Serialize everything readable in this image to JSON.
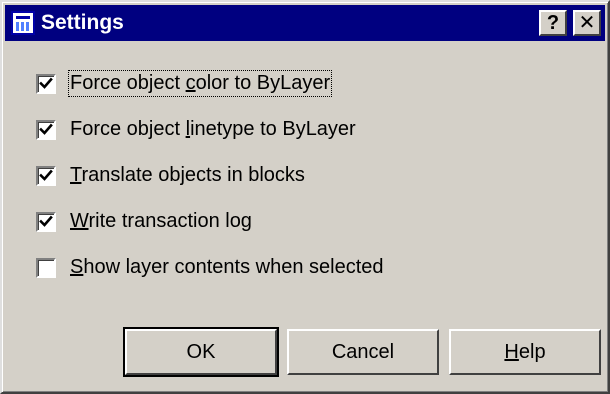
{
  "window": {
    "title": "Settings",
    "help_button_label": "?",
    "close_button_label": "✕"
  },
  "options": [
    {
      "pre": "Force object ",
      "mnemonic": "c",
      "post": "olor to ByLayer",
      "checked": true
    },
    {
      "pre": "Force object ",
      "mnemonic": "l",
      "post": "inetype to ByLayer",
      "checked": true
    },
    {
      "pre": "",
      "mnemonic": "T",
      "post": "ranslate objects in blocks",
      "checked": true
    },
    {
      "pre": "",
      "mnemonic": "W",
      "post": "rite transaction log",
      "checked": true
    },
    {
      "pre": "",
      "mnemonic": "S",
      "post": "how layer contents when selected",
      "checked": false
    }
  ],
  "buttons": {
    "ok": "OK",
    "cancel": "Cancel",
    "help_mnemonic": "H",
    "help_rest": "elp"
  }
}
